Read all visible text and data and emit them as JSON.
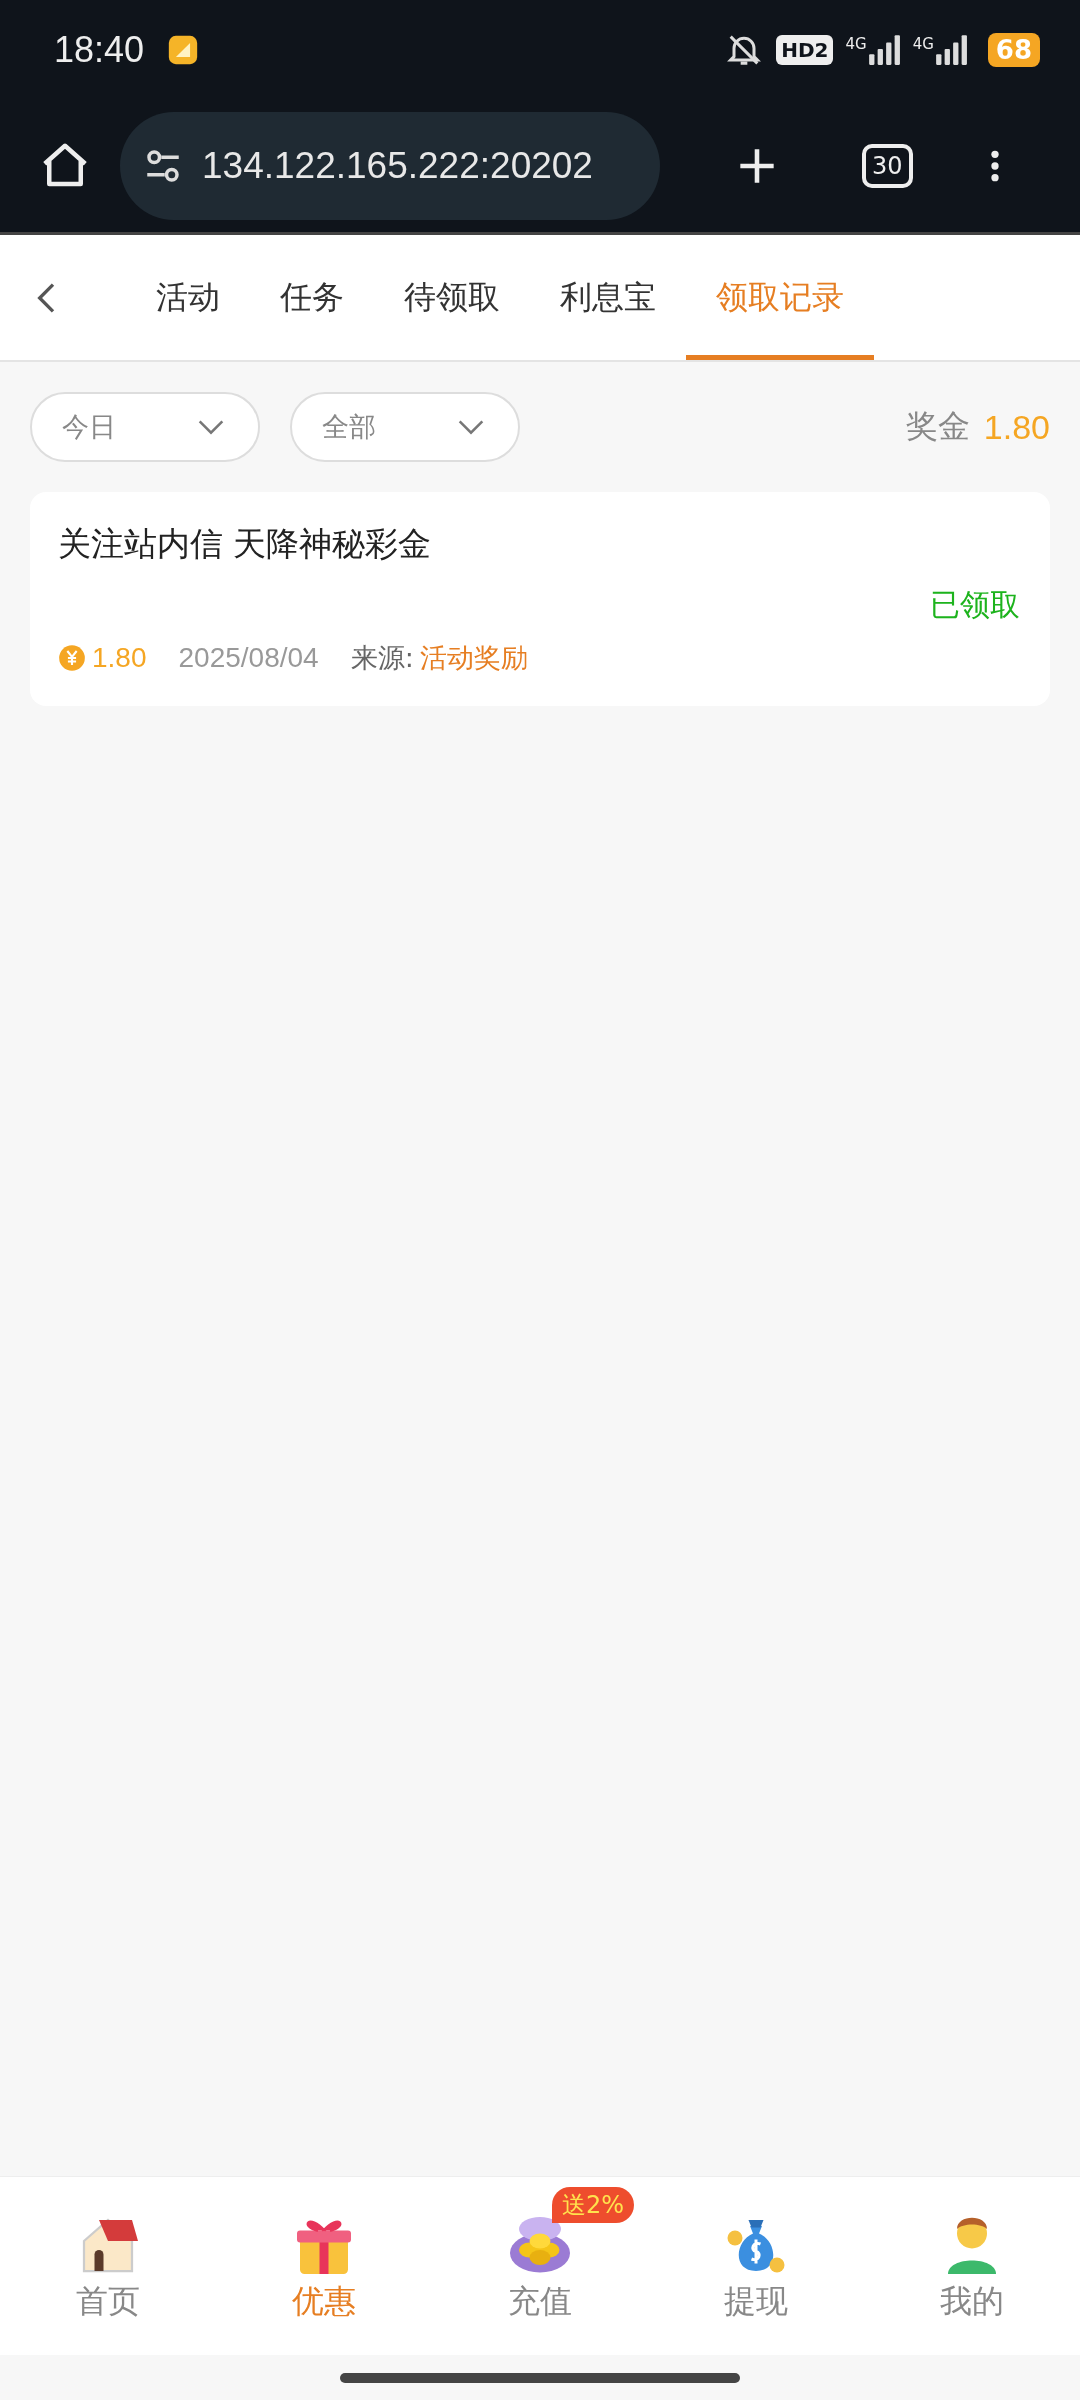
{
  "status_bar": {
    "time": "18:40",
    "network_badge": "HD2",
    "signal_1": "4G",
    "signal_2": "4G",
    "battery": "68"
  },
  "browser": {
    "url": "134.122.165.222:20202",
    "tab_count": "30"
  },
  "tabs": [
    {
      "label": "活动",
      "selected": false
    },
    {
      "label": "任务",
      "selected": false
    },
    {
      "label": "待领取",
      "selected": false
    },
    {
      "label": "利息宝",
      "selected": false
    },
    {
      "label": "领取记录",
      "selected": true
    }
  ],
  "filters": [
    {
      "value": "今日"
    },
    {
      "value": "全部"
    }
  ],
  "bonus": {
    "label": "奖金",
    "value": "1.80"
  },
  "records": [
    {
      "title": "关注站内信 天降神秘彩金",
      "status": "已领取",
      "amount": "1.80",
      "date": "2025/08/04",
      "source_label": "来源:",
      "source": "活动奖励"
    }
  ],
  "bottom_nav": [
    {
      "label": "首页",
      "kind": "house",
      "selected": false
    },
    {
      "label": "优惠",
      "kind": "gift",
      "selected": true
    },
    {
      "label": "充值",
      "kind": "coins",
      "selected": false,
      "badge": "送2%"
    },
    {
      "label": "提现",
      "kind": "moneybag",
      "selected": false
    },
    {
      "label": "我的",
      "kind": "person",
      "selected": false
    }
  ]
}
